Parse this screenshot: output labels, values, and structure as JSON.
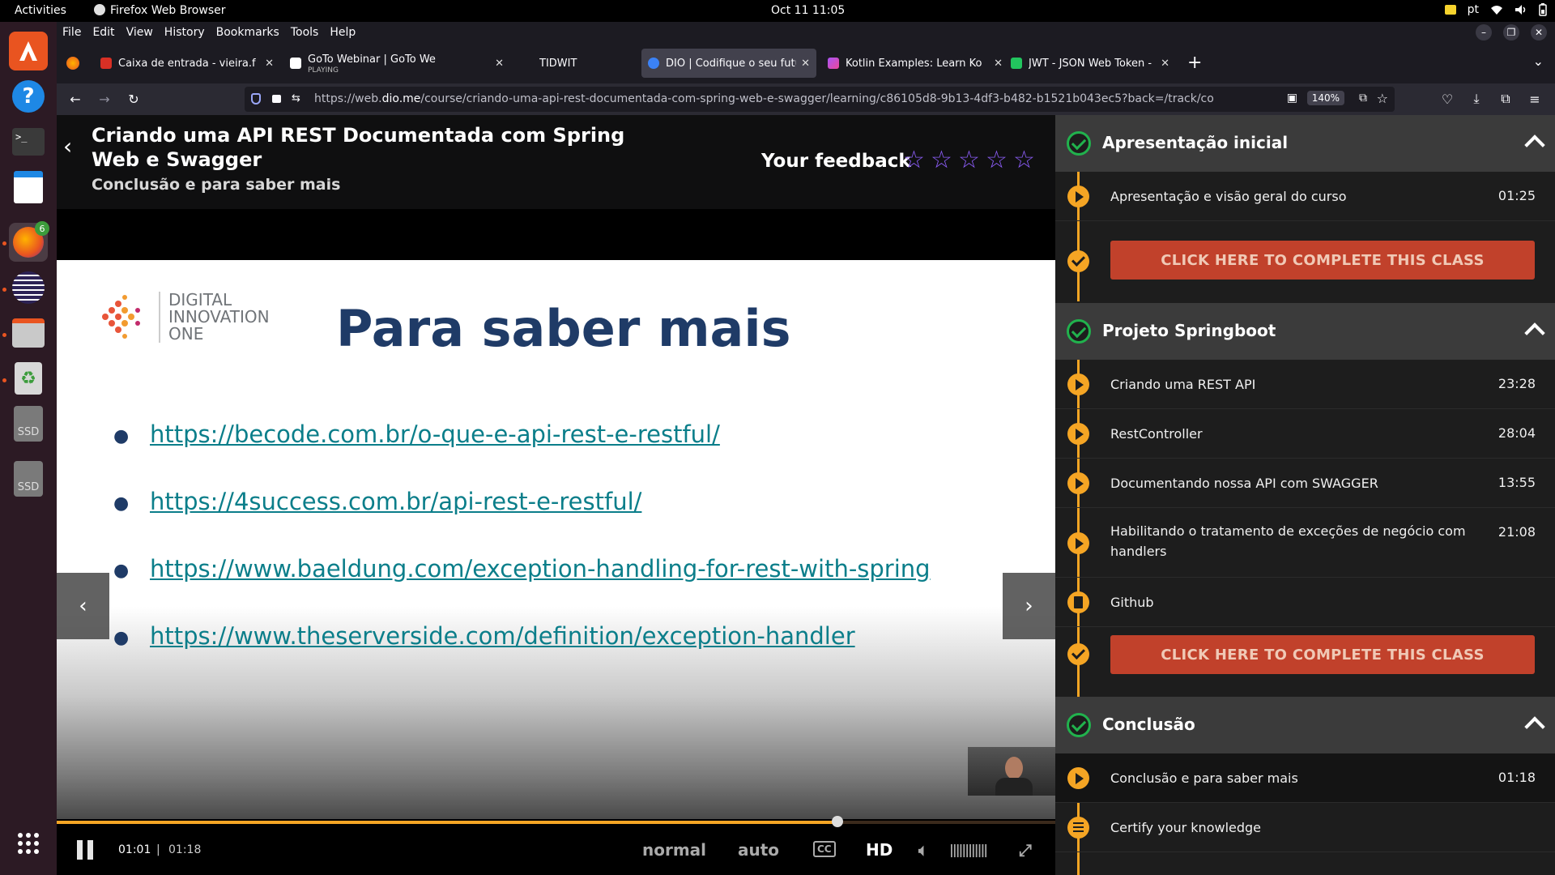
{
  "system": {
    "activities": "Activities",
    "app_name": "Firefox Web Browser",
    "clock": "Oct 11  11:05",
    "language": "pt"
  },
  "dock": {
    "firefox_badge": "6",
    "ssd1": "SSD",
    "ssd2": "SSD"
  },
  "menu": [
    "File",
    "Edit",
    "View",
    "History",
    "Bookmarks",
    "Tools",
    "Help"
  ],
  "tabs": [
    {
      "title": "Caixa de entrada - vieira.f",
      "favicon_color": "#d93025"
    },
    {
      "title": "GoTo Webinar | GoTo We",
      "subtitle": "PLAYING",
      "favicon_color": "#ffffff"
    },
    {
      "title": "TIDWIT",
      "favicon_color": "#1c1b22"
    },
    {
      "title": "DIO | Codifique o seu futu",
      "favicon_color": "#3b82f6"
    },
    {
      "title": "Kotlin Examples: Learn Ko",
      "favicon_color": "#a855f7"
    },
    {
      "title": "JWT - JSON Web Token - ",
      "favicon_color": "#22c55e"
    }
  ],
  "urlbar": {
    "prefix": "https://web.",
    "domain": "dio.me",
    "path": "/course/criando-uma-api-rest-documentada-com-spring-web-e-swagger/learning/c86105d8-9b13-4df3-b482-b1521b043ec5?back=/track/co",
    "zoom": "140%"
  },
  "course": {
    "title": "Criando uma API REST Documentada com Spring Web e Swagger",
    "subtitle": "Conclusão e para saber mais",
    "feedback_label": "Your feedback",
    "stars": 5
  },
  "slide": {
    "logo_line1": "DIGITAL",
    "logo_line2": "INNOVATION",
    "logo_line3": "ONE",
    "title": "Para saber mais",
    "links": [
      "https://becode.com.br/o-que-e-api-rest-e-restful/",
      "https://4success.com.br/api-rest-e-restful/",
      "https://www.baeldung.com/exception-handling-for-rest-with-spring",
      "https://www.theserverside.com/definition/exception-handler"
    ]
  },
  "player": {
    "current_time": "01:01",
    "separator": "|",
    "duration": "01:18",
    "progress_fraction": 0.782,
    "speed": "normal",
    "quality_mode": "auto",
    "cc": "CC",
    "hd": "HD"
  },
  "sidebar": {
    "complete_label": "CLICK HERE TO COMPLETE THIS CLASS",
    "sections": [
      {
        "title": "Apresentação inicial",
        "items": [
          {
            "label": "Apresentação e visão geral do curso",
            "time": "01:25"
          }
        ]
      },
      {
        "title": "Projeto Springboot",
        "items": [
          {
            "label": "Criando uma REST API",
            "time": "23:28"
          },
          {
            "label": "RestController",
            "time": "28:04"
          },
          {
            "label": "Documentando nossa API com SWAGGER",
            "time": "13:55"
          },
          {
            "label": "Habilitando o tratamento de exceções de negócio com handlers",
            "time": "21:08"
          },
          {
            "label": "Github",
            "time": ""
          }
        ]
      },
      {
        "title": "Conclusão",
        "items": [
          {
            "label": "Conclusão e para saber mais",
            "time": "01:18"
          },
          {
            "label": "Certify your knowledge",
            "time": ""
          }
        ]
      }
    ]
  },
  "colors": {
    "accent_orange": "#f5a524",
    "complete_button": "#c1412b",
    "check_green": "#21b24d",
    "star_purple": "#8b5cf6",
    "slide_title": "#1f3b67",
    "link": "#0b7e8a"
  }
}
